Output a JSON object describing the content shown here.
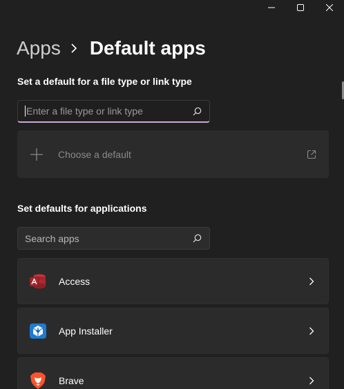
{
  "window": {
    "minimize_icon": "minimize-icon",
    "maximize_icon": "maximize-icon",
    "close_icon": "close-icon"
  },
  "breadcrumb": {
    "parent": "Apps",
    "current": "Default apps"
  },
  "file_type_section": {
    "title": "Set a default for a file type or link type",
    "search_placeholder": "Enter a file type or link type",
    "search_value": "",
    "choose_label": "Choose a default"
  },
  "apps_section": {
    "title": "Set defaults for applications",
    "search_placeholder": "Search apps",
    "apps": [
      {
        "name": "Access",
        "icon": "access-icon"
      },
      {
        "name": "App Installer",
        "icon": "app-installer-icon"
      },
      {
        "name": "Brave",
        "icon": "brave-icon"
      }
    ]
  },
  "colors": {
    "background": "#202020",
    "card": "#2b2b2b",
    "focus_underline": "#c9a8d9"
  }
}
